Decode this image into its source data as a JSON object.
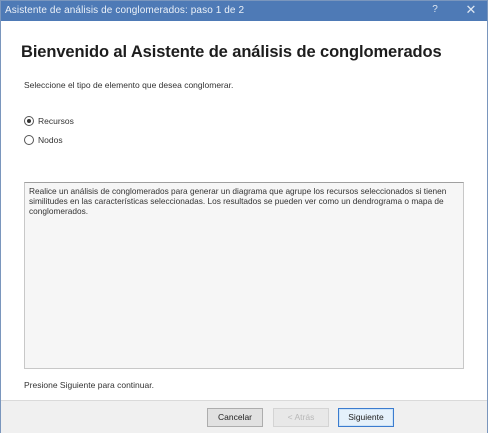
{
  "window": {
    "title": "Asistente de análisis de conglomerados: paso 1 de 2",
    "help_glyph": "?",
    "close_glyph": "✕"
  },
  "heading": "Bienvenido al Asistente de análisis de conglomerados",
  "instruction": "Seleccione el tipo de elemento que desea conglomerar.",
  "options": [
    {
      "label": "Recursos",
      "selected": true
    },
    {
      "label": "Nodos",
      "selected": false
    }
  ],
  "description": "Realice un análisis de conglomerados para generar un diagrama que agrupe los recursos seleccionados si tienen similitudes en las características seleccionadas. Los resultados se pueden ver como un dendrograma o mapa de conglomerados.",
  "continue_text": "Presione Siguiente para continuar.",
  "buttons": {
    "cancel": "Cancelar",
    "back": "< Atrás",
    "next": "Siguiente"
  },
  "colors": {
    "titlebar": "#4e7ab6",
    "default_button_border": "#3b7ccf"
  }
}
